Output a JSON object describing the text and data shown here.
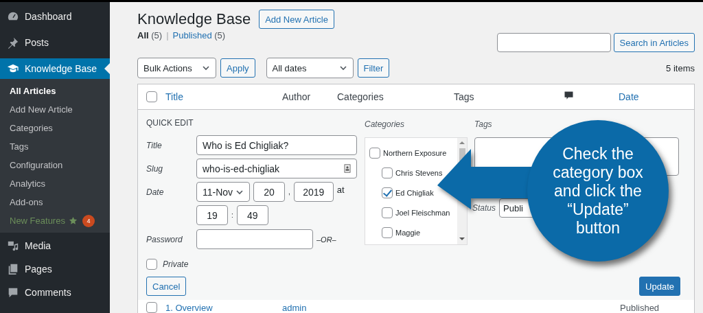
{
  "sidebar": {
    "items": [
      {
        "label": "Dashboard",
        "selected": false
      },
      {
        "label": "Posts",
        "selected": false
      },
      {
        "label": "Knowledge Base",
        "selected": true,
        "children": [
          {
            "label": "All Articles",
            "selected": true
          },
          {
            "label": "Add New Article",
            "selected": false
          },
          {
            "label": "Categories",
            "selected": false
          },
          {
            "label": "Tags",
            "selected": false
          },
          {
            "label": "Configuration",
            "selected": false
          },
          {
            "label": "Analytics",
            "selected": false
          },
          {
            "label": "Add-ons",
            "selected": false
          },
          {
            "label": "New Features",
            "selected": false,
            "highlight": true,
            "badge": "4"
          }
        ]
      },
      {
        "label": "Media",
        "selected": false
      },
      {
        "label": "Pages",
        "selected": false
      },
      {
        "label": "Comments",
        "selected": false
      }
    ]
  },
  "page": {
    "title": "Knowledge Base",
    "add_button": "Add New Article"
  },
  "filters": [
    {
      "label": "All",
      "count": "(5)",
      "selected": true
    },
    {
      "label": "Published",
      "count": "(5)",
      "selected": false
    }
  ],
  "filter_separator": "|",
  "search": {
    "button": "Search in Articles"
  },
  "toolbar": {
    "bulk_actions": "Bulk Actions",
    "apply": "Apply",
    "dates": "All dates",
    "filter": "Filter",
    "items_count": "5 items"
  },
  "table": {
    "columns": [
      {
        "label": "Title",
        "kind": "link"
      },
      {
        "label": "Author",
        "kind": "text"
      },
      {
        "label": "Categories",
        "kind": "text"
      },
      {
        "label": "Tags",
        "kind": "text"
      },
      {
        "kind": "comment-icon"
      },
      {
        "label": "Date",
        "kind": "link"
      }
    ],
    "header_checked": false,
    "rows": [
      {
        "checked": false,
        "title": "1. Overview",
        "author": "admin",
        "date": "Published"
      }
    ]
  },
  "quick_edit": {
    "heading": "QUICK EDIT",
    "title_label": "Title",
    "title_value": "Who is Ed Chigliak?",
    "slug_label": "Slug",
    "slug_value": "who-is-ed-chigliak",
    "date_label": "Date",
    "month": "11-Nov",
    "day": "20",
    "day_sep": ",",
    "year": "2019",
    "at": "at",
    "hour": "19",
    "time_sep": ":",
    "minute": "49",
    "password_label": "Password",
    "or": "–OR–",
    "private_label": "Private",
    "private_checked": false,
    "categories_label": "Categories",
    "categories": [
      {
        "label": "Northern Exposure",
        "checked": false,
        "children": [
          {
            "label": "Chris Stevens",
            "checked": false
          },
          {
            "label": "Ed Chigliak",
            "checked": true
          },
          {
            "label": "Joel Fleischman",
            "checked": false
          },
          {
            "label": "Maggie",
            "checked": false
          }
        ]
      }
    ],
    "tags_label": "Tags",
    "status_label": "Status",
    "status_value": "Publi",
    "cancel": "Cancel",
    "update": "Update"
  },
  "callout": {
    "text": "Check the category box and click the “Update” button"
  }
}
